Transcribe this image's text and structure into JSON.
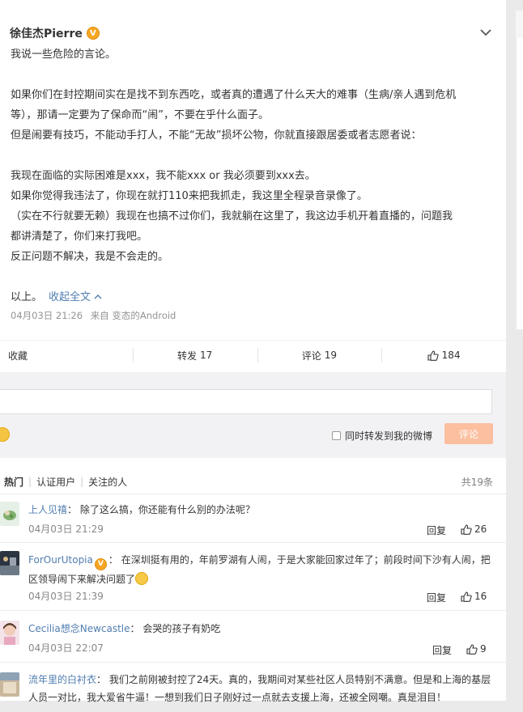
{
  "post": {
    "author": "徐佳杰Pierre",
    "verified_badge": "V",
    "lines": [
      "我说一些危险的言论。",
      "",
      "如果你们在封控期间实在是找不到东西吃，或者真的遭遇了什么天大的难事（生病/亲人遇到危机",
      "等），那请一定要为了保命而“闹”，不要在乎什么面子。",
      "但是闹要有技巧，不能动手打人，不能“无故”损坏公物，你就直接跟居委或者志愿者说：",
      "",
      "我现在面临的实际困难是xxx，我不能xxx or 我必须要到xxx去。",
      "如果你觉得我违法了，你现在就打110来把我抓走，我这里全程录音录像了。",
      "（实在不行就要无赖）我现在也搞不过你们，我就躺在这里了，我这边手机开着直播的，问题我",
      "都讲清楚了，你们来打我吧。",
      "反正问题不解决，我是不会走的。",
      "",
      "以上。"
    ],
    "collapse_label": "收起全文",
    "time": "04月03日 21:26",
    "source": "来自 变态的Android"
  },
  "toolbar": {
    "collect_label": "收藏",
    "repost_label": "转发",
    "repost_count": "17",
    "comment_label": "评论",
    "comment_count": "19",
    "like_count": "184"
  },
  "composer": {
    "input_value": "",
    "repost_option_label": "同时转发到我的微博",
    "submit_label": "评论"
  },
  "filters": {
    "items": [
      "热门",
      "认证用户",
      "关注的人"
    ],
    "total": "共19条"
  },
  "comments": [
    {
      "user": "上人见禧",
      "text": "除了这么搞，你还能有什么别的办法呢？",
      "time": "04月03日 21:29",
      "reply_label": "回复",
      "likes": "26"
    },
    {
      "user": "ForOurUtopia",
      "verified_badge": "V",
      "text": "在深圳挺有用的，年前罗湖有人闹，于是大家能回家过年了；前段时间下沙有人闹，把",
      "text2": "区领导闹下来解决问题了",
      "time": "04月03日 21:39",
      "reply_label": "回复",
      "likes": "16"
    },
    {
      "user": "Cecilia想念Newcastle",
      "text": "会哭的孩子有奶吃",
      "time": "04月03日 22:07",
      "reply_label": "回复",
      "likes": "9"
    },
    {
      "user": "流年里的白衬衣",
      "text": "我们之前刚被封控了24天。真的，我期间对某些社区人员特别不满意。但是和上海的基层",
      "text2": "人员一对比，我大爱省牛逼！一想到我们日子刚好过一点就去支援上海，还被全网嘲。真是泪目！"
    }
  ],
  "colors": {
    "link": "#507daf",
    "accent_button": "#fcbf9f",
    "badge": "#f6a623"
  }
}
